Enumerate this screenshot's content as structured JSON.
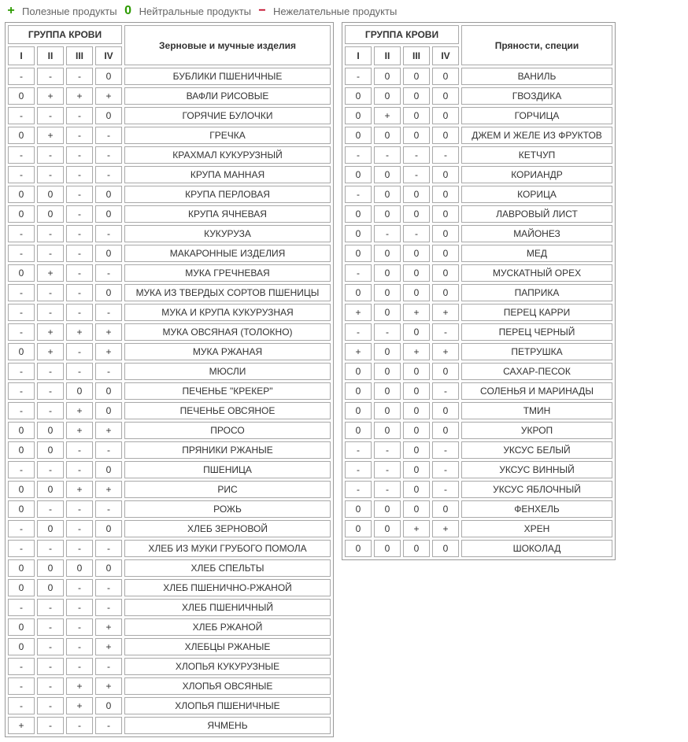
{
  "legend": {
    "plus": {
      "symbol": "+",
      "label": "Полезные продукты"
    },
    "zero": {
      "symbol": "0",
      "label": "Нейтральные продукты"
    },
    "minus": {
      "symbol": "−",
      "label": "Нежелательные продукты"
    }
  },
  "group_header": "ГРУППА КРОВИ",
  "columns": [
    "I",
    "II",
    "III",
    "IV"
  ],
  "tables": [
    {
      "category": "Зерновые и мучные изделия",
      "rows": [
        {
          "v": [
            "-",
            "-",
            "-",
            "0"
          ],
          "name": "БУБЛИКИ ПШЕНИЧНЫЕ"
        },
        {
          "v": [
            "0",
            "+",
            "+",
            "+"
          ],
          "name": "ВАФЛИ РИСОВЫЕ"
        },
        {
          "v": [
            "-",
            "-",
            "-",
            "0"
          ],
          "name": "ГОРЯЧИЕ БУЛОЧКИ"
        },
        {
          "v": [
            "0",
            "+",
            "-",
            "-"
          ],
          "name": "ГРЕЧКА"
        },
        {
          "v": [
            "-",
            "-",
            "-",
            "-"
          ],
          "name": "КРАХМАЛ КУКУРУЗНЫЙ"
        },
        {
          "v": [
            "-",
            "-",
            "-",
            "-"
          ],
          "name": "КРУПА МАННАЯ"
        },
        {
          "v": [
            "0",
            "0",
            "-",
            "0"
          ],
          "name": "КРУПА ПЕРЛОВАЯ"
        },
        {
          "v": [
            "0",
            "0",
            "-",
            "0"
          ],
          "name": "КРУПА ЯЧНЕВАЯ"
        },
        {
          "v": [
            "-",
            "-",
            "-",
            "-"
          ],
          "name": "КУКУРУЗА"
        },
        {
          "v": [
            "-",
            "-",
            "-",
            "0"
          ],
          "name": "МАКАРОННЫЕ ИЗДЕЛИЯ"
        },
        {
          "v": [
            "0",
            "+",
            "-",
            "-"
          ],
          "name": "МУКА ГРЕЧНЕВАЯ"
        },
        {
          "v": [
            "-",
            "-",
            "-",
            "0"
          ],
          "name": "МУКА ИЗ ТВЕРДЫХ СОРТОВ ПШЕНИЦЫ"
        },
        {
          "v": [
            "-",
            "-",
            "-",
            "-"
          ],
          "name": "МУКА И КРУПА КУКУРУЗНАЯ"
        },
        {
          "v": [
            "-",
            "+",
            "+",
            "+"
          ],
          "name": "МУКА ОВСЯНАЯ (ТОЛОКНО)"
        },
        {
          "v": [
            "0",
            "+",
            "-",
            "+"
          ],
          "name": "МУКА РЖАНАЯ"
        },
        {
          "v": [
            "-",
            "-",
            "-",
            "-"
          ],
          "name": "МЮСЛИ"
        },
        {
          "v": [
            "-",
            "-",
            "0",
            "0"
          ],
          "name": "ПЕЧЕНЬЕ \"КРЕКЕР\""
        },
        {
          "v": [
            "-",
            "-",
            "+",
            "0"
          ],
          "name": "ПЕЧЕНЬЕ ОВСЯНОЕ"
        },
        {
          "v": [
            "0",
            "0",
            "+",
            "+"
          ],
          "name": "ПРОСО"
        },
        {
          "v": [
            "0",
            "0",
            "-",
            "-"
          ],
          "name": "ПРЯНИКИ РЖАНЫЕ"
        },
        {
          "v": [
            "-",
            "-",
            "-",
            "0"
          ],
          "name": "ПШЕНИЦА"
        },
        {
          "v": [
            "0",
            "0",
            "+",
            "+"
          ],
          "name": "РИС"
        },
        {
          "v": [
            "0",
            "-",
            "-",
            "-"
          ],
          "name": "РОЖЬ"
        },
        {
          "v": [
            "-",
            "0",
            "-",
            "0"
          ],
          "name": "ХЛЕБ ЗЕРНОВОЙ"
        },
        {
          "v": [
            "-",
            "-",
            "-",
            "-"
          ],
          "name": "ХЛЕБ ИЗ МУКИ ГРУБОГО ПОМОЛА"
        },
        {
          "v": [
            "0",
            "0",
            "0",
            "0"
          ],
          "name": "ХЛЕБ СПЕЛЬТЫ"
        },
        {
          "v": [
            "0",
            "0",
            "-",
            "-"
          ],
          "name": "ХЛЕБ ПШЕНИЧНО-РЖАНОЙ"
        },
        {
          "v": [
            "-",
            "-",
            "-",
            "-"
          ],
          "name": "ХЛЕБ ПШЕНИЧНЫЙ"
        },
        {
          "v": [
            "0",
            "-",
            "-",
            "+"
          ],
          "name": "ХЛЕБ РЖАНОЙ"
        },
        {
          "v": [
            "0",
            "-",
            "-",
            "+"
          ],
          "name": "ХЛЕБЦЫ РЖАНЫЕ"
        },
        {
          "v": [
            "-",
            "-",
            "-",
            "-"
          ],
          "name": "ХЛОПЬЯ КУКУРУЗНЫЕ"
        },
        {
          "v": [
            "-",
            "-",
            "+",
            "+"
          ],
          "name": "ХЛОПЬЯ ОВСЯНЫЕ"
        },
        {
          "v": [
            "-",
            "-",
            "+",
            "0"
          ],
          "name": "ХЛОПЬЯ ПШЕНИЧНЫЕ"
        },
        {
          "v": [
            "+",
            "-",
            "-",
            "-"
          ],
          "name": "ЯЧМЕНЬ"
        }
      ]
    },
    {
      "category": "Пряности, специи",
      "rows": [
        {
          "v": [
            "-",
            "0",
            "0",
            "0"
          ],
          "name": "ВАНИЛЬ"
        },
        {
          "v": [
            "0",
            "0",
            "0",
            "0"
          ],
          "name": "ГВОЗДИКА"
        },
        {
          "v": [
            "0",
            "+",
            "0",
            "0"
          ],
          "name": "ГОРЧИЦА"
        },
        {
          "v": [
            "0",
            "0",
            "0",
            "0"
          ],
          "name": "ДЖЕМ И ЖЕЛЕ ИЗ ФРУКТОВ"
        },
        {
          "v": [
            "-",
            "-",
            "-",
            "-"
          ],
          "name": "КЕТЧУП"
        },
        {
          "v": [
            "0",
            "0",
            "-",
            "0"
          ],
          "name": "КОРИАНДР"
        },
        {
          "v": [
            "-",
            "0",
            "0",
            "0"
          ],
          "name": "КОРИЦА"
        },
        {
          "v": [
            "0",
            "0",
            "0",
            "0"
          ],
          "name": "ЛАВРОВЫЙ ЛИСТ"
        },
        {
          "v": [
            "0",
            "-",
            "-",
            "0"
          ],
          "name": "МАЙОНЕЗ"
        },
        {
          "v": [
            "0",
            "0",
            "0",
            "0"
          ],
          "name": "МЕД"
        },
        {
          "v": [
            "-",
            "0",
            "0",
            "0"
          ],
          "name": "МУСКАТНЫЙ ОРЕХ"
        },
        {
          "v": [
            "0",
            "0",
            "0",
            "0"
          ],
          "name": "ПАПРИКА"
        },
        {
          "v": [
            "+",
            "0",
            "+",
            "+"
          ],
          "name": "ПЕРЕЦ КАРРИ"
        },
        {
          "v": [
            "-",
            "-",
            "0",
            "-"
          ],
          "name": "ПЕРЕЦ ЧЕРНЫЙ"
        },
        {
          "v": [
            "+",
            "0",
            "+",
            "+"
          ],
          "name": "ПЕТРУШКА"
        },
        {
          "v": [
            "0",
            "0",
            "0",
            "0"
          ],
          "name": "САХАР-ПЕСОК"
        },
        {
          "v": [
            "0",
            "0",
            "0",
            "-"
          ],
          "name": "СОЛЕНЬЯ И МАРИНАДЫ"
        },
        {
          "v": [
            "0",
            "0",
            "0",
            "0"
          ],
          "name": "ТМИН"
        },
        {
          "v": [
            "0",
            "0",
            "0",
            "0"
          ],
          "name": "УКРОП"
        },
        {
          "v": [
            "-",
            "-",
            "0",
            "-"
          ],
          "name": "УКСУС БЕЛЫЙ"
        },
        {
          "v": [
            "-",
            "-",
            "0",
            "-"
          ],
          "name": "УКСУС ВИННЫЙ"
        },
        {
          "v": [
            "-",
            "-",
            "0",
            "-"
          ],
          "name": "УКСУС ЯБЛОЧНЫЙ"
        },
        {
          "v": [
            "0",
            "0",
            "0",
            "0"
          ],
          "name": "ФЕНХЕЛЬ"
        },
        {
          "v": [
            "0",
            "0",
            "+",
            "+"
          ],
          "name": "ХРЕН"
        },
        {
          "v": [
            "0",
            "0",
            "0",
            "0"
          ],
          "name": "ШОКОЛАД"
        }
      ]
    }
  ]
}
